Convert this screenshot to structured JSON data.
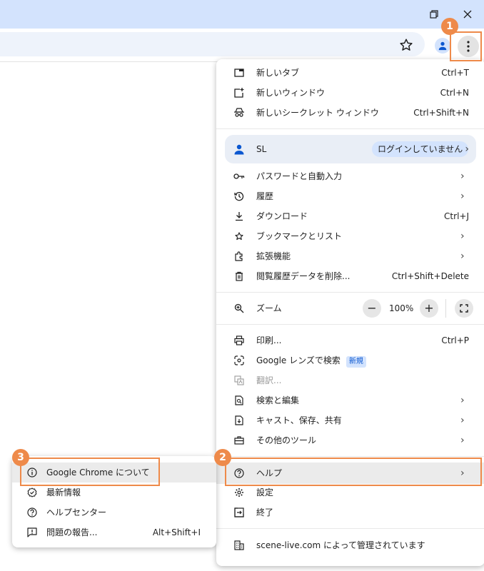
{
  "window": {
    "title_bar_color": "#d3e3fd"
  },
  "accent_color": "#ee8a4a",
  "callouts": [
    "1",
    "2",
    "3"
  ],
  "menu": {
    "new_tab": {
      "label": "新しいタブ",
      "shortcut": "Ctrl+T"
    },
    "new_window": {
      "label": "新しいウィンドウ",
      "shortcut": "Ctrl+N"
    },
    "new_incognito": {
      "label": "新しいシークレット ウィンドウ",
      "shortcut": "Ctrl+Shift+N"
    },
    "profile": {
      "name": "SL",
      "status": "ログインしていません"
    },
    "passwords": {
      "label": "パスワードと自動入力"
    },
    "history": {
      "label": "履歴"
    },
    "downloads": {
      "label": "ダウンロード",
      "shortcut": "Ctrl+J"
    },
    "bookmarks": {
      "label": "ブックマークとリスト"
    },
    "extensions": {
      "label": "拡張機能"
    },
    "clear_data": {
      "label": "閲覧履歴データを削除...",
      "shortcut": "Ctrl+Shift+Delete"
    },
    "zoom": {
      "label": "ズーム",
      "value": "100%",
      "minus": "−",
      "plus": "+"
    },
    "print": {
      "label": "印刷...",
      "shortcut": "Ctrl+P"
    },
    "lens": {
      "label": "Google レンズで検索",
      "badge": "新規"
    },
    "translate": {
      "label": "翻訳..."
    },
    "find_edit": {
      "label": "検索と編集"
    },
    "cast_save": {
      "label": "キャスト、保存、共有"
    },
    "more_tools": {
      "label": "その他のツール"
    },
    "help": {
      "label": "ヘルプ"
    },
    "settings": {
      "label": "設定"
    },
    "exit": {
      "label": "終了"
    },
    "managed": {
      "label": "scene-live.com によって管理されています"
    }
  },
  "help_submenu": {
    "about": {
      "label": "Google Chrome について"
    },
    "whats_new": {
      "label": "最新情報"
    },
    "help_center": {
      "label": "ヘルプセンター"
    },
    "report": {
      "label": "問題の報告...",
      "shortcut": "Alt+Shift+I"
    }
  }
}
